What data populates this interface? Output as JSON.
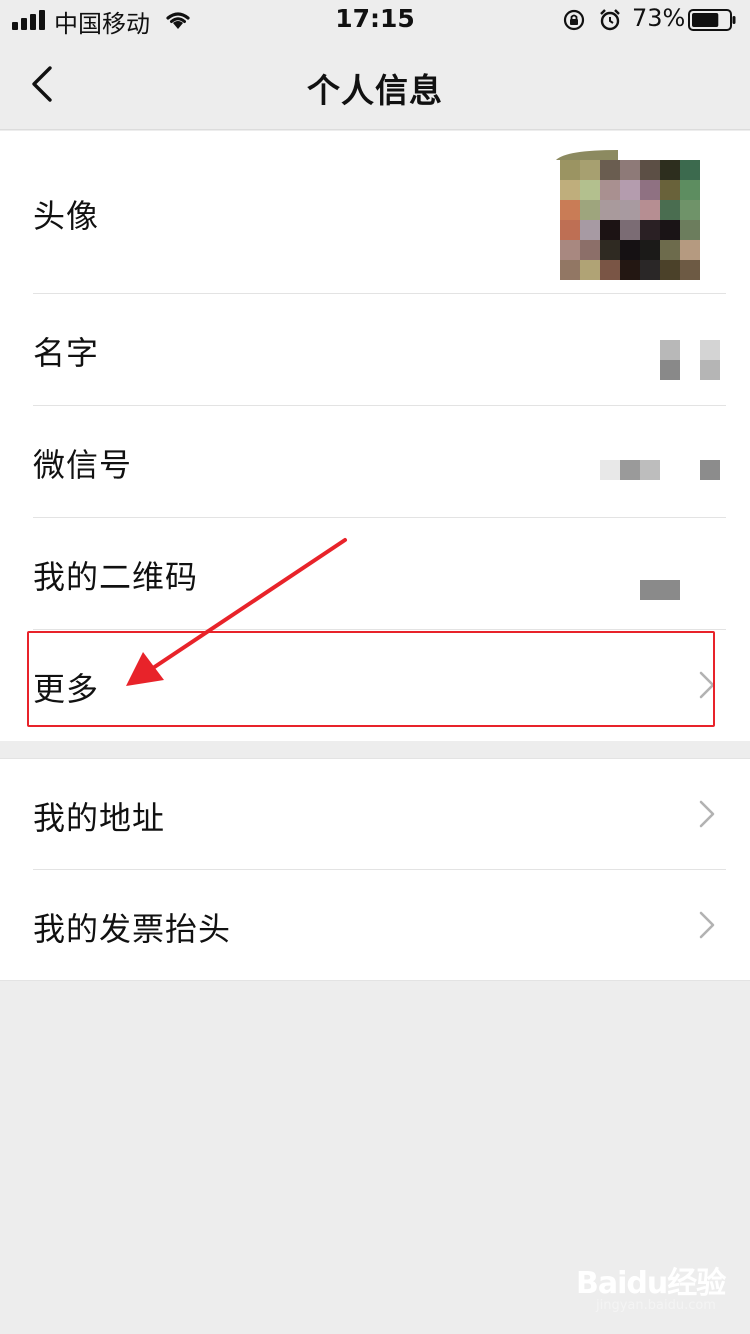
{
  "status_bar": {
    "carrier": "中国移动",
    "time": "17:15",
    "battery_percent": "73%",
    "battery_level": 0.73,
    "icons": [
      "signal-icon",
      "wifi-icon",
      "rotation-lock-icon",
      "alarm-icon",
      "battery-icon"
    ]
  },
  "nav": {
    "title": "个人信息",
    "back_icon": "chevron-left-icon"
  },
  "groups": [
    {
      "items": [
        {
          "label": "头像",
          "value_type": "avatar-image"
        },
        {
          "label": "名字",
          "value_type": "redacted-text"
        },
        {
          "label": "微信号",
          "value_type": "redacted-text"
        },
        {
          "label": "我的二维码",
          "value_type": "redacted-icon"
        },
        {
          "label": "更多",
          "value_type": "chevron"
        }
      ]
    },
    {
      "items": [
        {
          "label": "我的地址",
          "value_type": "chevron"
        },
        {
          "label": "我的发票抬头",
          "value_type": "chevron"
        }
      ]
    }
  ],
  "annotation": {
    "highlight_color": "#e8232a",
    "highlighted_item": "更多"
  },
  "watermark": {
    "brand": "Baidu经验",
    "url": "jingyan.baidu.com"
  },
  "colors": {
    "background": "#ededed",
    "cell": "#ffffff",
    "divider": "#e3e3e3",
    "chevron": "#b2b2b2"
  },
  "avatar_pixels": [
    "#9b9462",
    "#a7a070",
    "#6a5d50",
    "#8e7a78",
    "#5c4f45",
    "#2d2e1e",
    "#3c6a4e",
    "#bfae7c",
    "#b3c08e",
    "#a99090",
    "#b49cae",
    "#8f7182",
    "#69623a",
    "#5d8d60",
    "#c97c56",
    "#9ea57d",
    "#a99a9c",
    "#a89aa0",
    "#b68e92",
    "#4a6d50",
    "#6f9369",
    "#be6f54",
    "#a79aa3",
    "#1c1314",
    "#7b6c74",
    "#2a2024",
    "#1a1416",
    "#6c7d5d",
    "#a88880",
    "#8c6f69",
    "#2f2a22",
    "#151113",
    "#1b1a18",
    "#6d6b4c",
    "#b59a80",
    "#927764",
    "#b0a375",
    "#7a5545",
    "#231712",
    "#2a2727",
    "#4b4129",
    "#6d5a44"
  ]
}
